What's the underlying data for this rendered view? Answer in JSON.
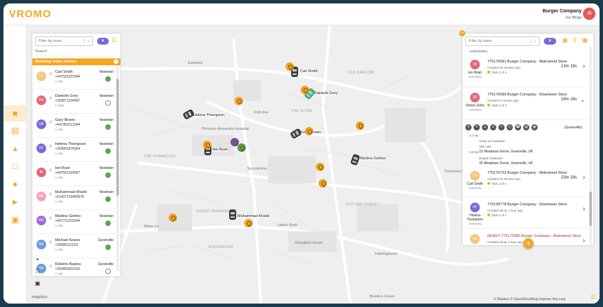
{
  "brand": {
    "logo": "VROMO",
    "accent": "#f5a623"
  },
  "header": {
    "company": "Burger Company",
    "user": "Joe Blogs",
    "initials": "JB"
  },
  "sidenav": [
    "dashboard-icon",
    "orders-icon",
    "analytics-icon",
    "documents-icon",
    "drivers-icon",
    "marketing-icon",
    "reports-icon"
  ],
  "left_panel": {
    "filter_placeholder": "Filter by team",
    "search_placeholder": "Search",
    "online_banner": "Showing online drivers",
    "drivers": [
      {
        "initials": "CS",
        "color": "#f5c67a",
        "name": "Carl Smith",
        "phone": "+447591223344",
        "jobs": "1 Job",
        "team": "Newtown",
        "status": "on"
      },
      {
        "initials": "DG",
        "color": "#e06a7a",
        "name": "Danielle Grey",
        "phone": "+353871234567",
        "jobs": "0 Jobs",
        "team": "Newtown",
        "status": "off"
      },
      {
        "initials": "GB",
        "color": "#7a6ad8",
        "name": "Gary Brown",
        "phone": "+447952213344",
        "jobs": "1 Job",
        "team": "Newtown",
        "status": "on"
      },
      {
        "initials": "HT",
        "color": "#7a6ad8",
        "name": "Helena Thompson",
        "phone": "+353859376564",
        "jobs": "1 Job",
        "team": "Newtown",
        "status": "on"
      },
      {
        "initials": "IR",
        "color": "#e06a7a",
        "name": "Ian Ryan",
        "phone": "+447591234567",
        "jobs": "1 Job",
        "team": "Newtown",
        "status": "on"
      },
      {
        "initials": "MK",
        "color": "#f5a0c0",
        "name": "Muhammad Khalid",
        "phone": "+61437123456978",
        "jobs": "1 Job",
        "team": "Newtown",
        "status": "on"
      },
      {
        "initials": "MG",
        "color": "#a06ad8",
        "name": "Martina Golimo",
        "phone": "+447711223344",
        "jobs": "1 Job",
        "team": "Newtown",
        "status": "on"
      },
      {
        "initials": "MK",
        "color": "#6a9ad8",
        "name": "Michael Keane",
        "phone": "+353851111111",
        "jobs": "1 Job",
        "team": "Greenville",
        "status": "on"
      },
      {
        "initials": "RB",
        "color": "#6a9ad8",
        "name": "Roberts Bastos",
        "phone": "+353850010102",
        "jobs": "1 Job",
        "team": "Greenville",
        "status": "off"
      }
    ]
  },
  "right_panel": {
    "filter_placeholder": "Filter by team",
    "top_label": "underdonkey",
    "orders": [
      {
        "initials": "IR",
        "color": "#e06a7a",
        "driver": "Ian Ryan",
        "sub": "underdoky",
        "title": "775176091 Burger Company - Mainstreet Store",
        "created": "Created 10 minutes ago",
        "tasks": "Task 2 of 4",
        "eta": "13m 19s"
      },
      {
        "initials": "SZ",
        "color": "#e06a7a",
        "driver": "Simon Zebo",
        "sub": "underdoky",
        "title": "775176099 Burger Company - Downtown Store",
        "created": "Created 5 minutes ago",
        "tasks": "Task 2 of 4",
        "eta": "18m 19s"
      },
      {
        "initials": "CS",
        "color": "#f5c67a",
        "driver": "Carl Smith",
        "sub": "underdoky",
        "title": "775176722 Burger Company - Mainstreet Store",
        "created": "Created 10 minutes ago",
        "tasks": "Task 2 of 4",
        "eta": "23m 19s"
      },
      {
        "initials": "HT",
        "color": "#7a6ad8",
        "driver": "Helena Thompson",
        "sub": "underdoky",
        "title": "775199778 Burger Company - Downtown Store",
        "created": "Created about 1 hour ago",
        "tasks": "Task 0 of 4",
        "eta": ""
      },
      {
        "initials": "GB",
        "color": "#f5c67a",
        "driver": "",
        "sub": "",
        "title": "READY 775170380 Burger Company - Mainstreet Store",
        "created": "Created about 1 hour ago",
        "tasks": "",
        "eta": ""
      }
    ],
    "expanded": {
      "team_tag": "(Greenville)",
      "distance": "0.7 km",
      "arrive_label": "Arrive at Customer",
      "arrive_time": "10m 16s",
      "arrive_dist": "0.0 km",
      "arrive_addr": "15 Meadows Grove, Greenville, UK",
      "depart_label": "Depart Customer",
      "depart_addr": "15 Meadows Grove, Greenville, UK"
    }
  },
  "map": {
    "labels": [
      "Eastwick",
      "OLD HARLOW",
      "Princess Alexandra Hospital",
      "THE STOW",
      "THE PINNACLES",
      "POTTER STREET",
      "GREAT PARNDON",
      "Latton Bush",
      "KINGSMOOR",
      "Rowdell's Green",
      "Threshers Bush",
      "Hastingwood",
      "Bowlers Green",
      "First Ave",
      "Second Ave",
      "Water Ln"
    ],
    "drivers": [
      "Carl Smith",
      "Danielle Grey",
      "Helena Thompson",
      "Ian Ryan",
      "Gary Brown",
      "Martina Golimo",
      "Muhammad Khalid"
    ],
    "attribution": "© Mapbox © OpenStreetMap Improve this map",
    "mapbox": "mapbox"
  }
}
